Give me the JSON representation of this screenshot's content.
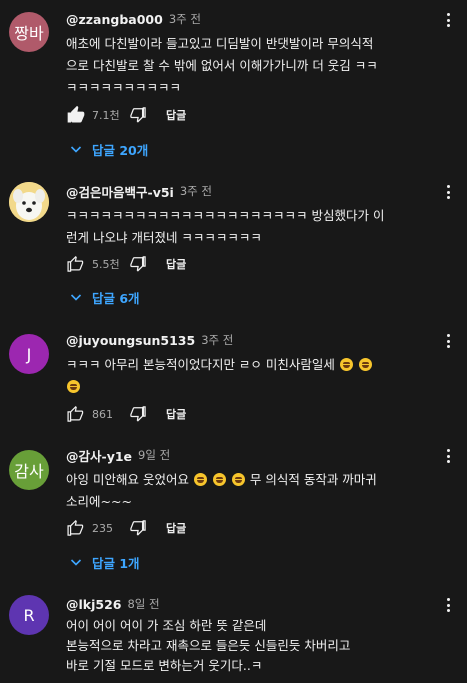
{
  "colors": {
    "background": "#181818",
    "link": "#3ea6ff",
    "meta": "#aaaaaa"
  },
  "comments": [
    {
      "avatar_text": "짱바",
      "avatar_color": "#b05a6a",
      "author": "@zzangba000",
      "time": "3주 전",
      "lines": [
        "애초에 다친발이라 들고있고 디딤발이 반댓발이라 무의식적",
        "으로 다친발로 찰 수 밖에 없어서 이해가가니까 더 웃김 ㅋㅋ",
        "ㅋㅋㅋㅋㅋㅋㅋㅋㅋㅋ"
      ],
      "likes": "7.1천",
      "reply_label": "답글",
      "replies_label": "답글 20개"
    },
    {
      "avatar_text": "",
      "avatar_color": "#f4d98c",
      "author": "@검은마음백구-v5i",
      "time": "3주 전",
      "lines": [
        "ㅋㅋㅋㅋㅋㅋㅋㅋㅋㅋㅋㅋㅋㅋㅋㅋㅋㅋㅋㅋㅋ 방심했다가 이",
        "런게 나오냐 개터졌네 ㅋㅋㅋㅋㅋㅋㅋ"
      ],
      "likes": "5.5천",
      "reply_label": "답글",
      "replies_label": "답글 6개"
    },
    {
      "avatar_text": "J",
      "avatar_color": "#9c27b0",
      "author": "@juyoungsun5135",
      "time": "3주 전",
      "line1_text": "ㅋㅋㅋ 아무리 본능적이었다지만 ㄹㅇ 미친사람일세",
      "likes": "861",
      "reply_label": "답글"
    },
    {
      "avatar_text": "감사",
      "avatar_color": "#689f38",
      "author": "@감사-y1e",
      "time": "9일 전",
      "line1_text_a": "아잉 미안해요 웃었어요",
      "line1_text_b": "무 의식적 동작과 까마귀",
      "line2_text": "소리에~~~",
      "likes": "235",
      "reply_label": "답글",
      "replies_label": "답글 1개"
    },
    {
      "avatar_text": "R",
      "avatar_color": "#5e35b1",
      "author": "@lkj526",
      "time": "8일 전",
      "lines": [
        "어이 어이 어이 가 조심 하란 뜻 같은데",
        "본능적으로 차라고 재촉으로 들은듯 신들린듯 차버리고",
        "바로 기절 모드로 변하는거 웃기다..ㅋ"
      ]
    }
  ]
}
